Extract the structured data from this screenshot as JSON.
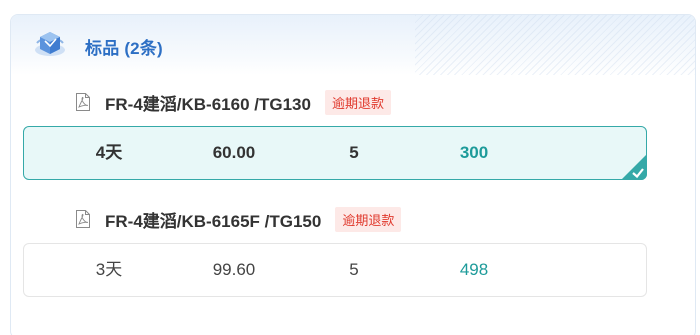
{
  "header": {
    "title": "标品 (2条)",
    "icon": "cube-package-icon"
  },
  "items": [
    {
      "name": "FR-4建滔/KB-6160 /TG130",
      "badge": "逾期退款",
      "selected": true,
      "quote": {
        "delivery": "4天",
        "price": "60.00",
        "quantity": "5",
        "total": "300"
      }
    },
    {
      "name": "FR-4建滔/KB-6165F /TG150",
      "badge": "逾期退款",
      "selected": false,
      "quote": {
        "delivery": "3天",
        "price": "99.60",
        "quantity": "5",
        "total": "498"
      }
    }
  ],
  "colors": {
    "accent": "#2d6fc4",
    "teal": "#1d9b9a",
    "badge_text": "#e0392d",
    "badge_bg": "#fde9e7"
  }
}
